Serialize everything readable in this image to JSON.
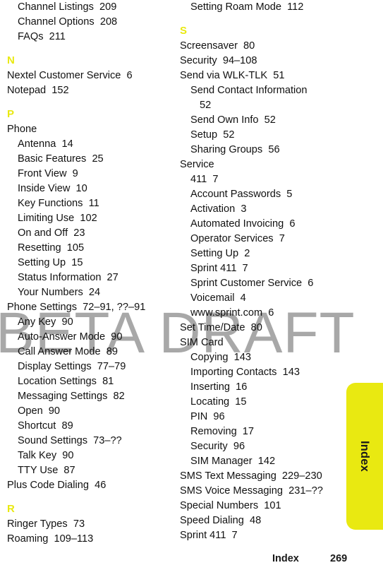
{
  "document": {
    "page_number": "269",
    "footer_label": "Index",
    "watermark_text": "BETA DRAFT",
    "tab_label": "Index",
    "accent_color": "#e9e911",
    "watermark_color": "#a8a8a8",
    "text_color": "#111111"
  },
  "columns": [
    {
      "id": "left",
      "blocks": [
        {
          "type": "entry",
          "level": 1,
          "text": "Channel Listings  209"
        },
        {
          "type": "entry",
          "level": 1,
          "text": "Channel Options  208"
        },
        {
          "type": "entry",
          "level": 1,
          "text": "FAQs  211"
        },
        {
          "type": "letter",
          "text": "N"
        },
        {
          "type": "entry",
          "level": 0,
          "text": "Nextel Customer Service  6"
        },
        {
          "type": "entry",
          "level": 0,
          "text": "Notepad  152"
        },
        {
          "type": "letter",
          "text": "P"
        },
        {
          "type": "entry",
          "level": 0,
          "text": "Phone"
        },
        {
          "type": "entry",
          "level": 1,
          "text": "Antenna  14"
        },
        {
          "type": "entry",
          "level": 1,
          "text": "Basic Features  25"
        },
        {
          "type": "entry",
          "level": 1,
          "text": "Front View  9"
        },
        {
          "type": "entry",
          "level": 1,
          "text": "Inside View  10"
        },
        {
          "type": "entry",
          "level": 1,
          "text": "Key Functions  11"
        },
        {
          "type": "entry",
          "level": 1,
          "text": "Limiting Use  102"
        },
        {
          "type": "entry",
          "level": 1,
          "text": "On and Off  23"
        },
        {
          "type": "entry",
          "level": 1,
          "text": "Resetting  105"
        },
        {
          "type": "entry",
          "level": 1,
          "text": "Setting Up  15"
        },
        {
          "type": "entry",
          "level": 1,
          "text": "Status Information  27"
        },
        {
          "type": "entry",
          "level": 1,
          "text": "Your Numbers  24"
        },
        {
          "type": "entry",
          "level": 0,
          "text": "Phone Settings  72–91, ??–91"
        },
        {
          "type": "entry",
          "level": 1,
          "text": "Any Key  90"
        },
        {
          "type": "entry",
          "level": 1,
          "text": "Auto-Answer Mode  90"
        },
        {
          "type": "entry",
          "level": 1,
          "text": "Call Answer Mode  89"
        },
        {
          "type": "entry",
          "level": 1,
          "text": "Display Settings  77–79"
        },
        {
          "type": "entry",
          "level": 1,
          "text": "Location Settings  81"
        },
        {
          "type": "entry",
          "level": 1,
          "text": "Messaging Settings  82"
        },
        {
          "type": "entry",
          "level": 1,
          "text": "Open  90"
        },
        {
          "type": "entry",
          "level": 1,
          "text": "Shortcut  89"
        },
        {
          "type": "entry",
          "level": 1,
          "text": "Sound Settings  73–??"
        },
        {
          "type": "entry",
          "level": 1,
          "text": "Talk Key  90"
        },
        {
          "type": "entry",
          "level": 1,
          "text": "TTY Use  87"
        },
        {
          "type": "entry",
          "level": 0,
          "text": "Plus Code Dialing  46"
        },
        {
          "type": "letter",
          "text": "R"
        },
        {
          "type": "entry",
          "level": 0,
          "text": "Ringer Types  73"
        },
        {
          "type": "entry",
          "level": 0,
          "text": "Roaming  109–113"
        }
      ]
    },
    {
      "id": "right",
      "blocks": [
        {
          "type": "entry",
          "level": 1,
          "text": "Setting Roam Mode  112"
        },
        {
          "type": "letter",
          "text": "S"
        },
        {
          "type": "entry",
          "level": 0,
          "text": "Screensaver  80"
        },
        {
          "type": "entry",
          "level": 0,
          "text": "Security  94–108"
        },
        {
          "type": "entry",
          "level": 0,
          "text": "Send via WLK-TLK  51"
        },
        {
          "type": "entry",
          "level": 1,
          "text": "Send Contact Information"
        },
        {
          "type": "entry",
          "level": 1,
          "continuation": true,
          "text": "52"
        },
        {
          "type": "entry",
          "level": 1,
          "text": "Send Own Info  52"
        },
        {
          "type": "entry",
          "level": 1,
          "text": "Setup  52"
        },
        {
          "type": "entry",
          "level": 1,
          "text": "Sharing Groups  56"
        },
        {
          "type": "entry",
          "level": 0,
          "text": "Service"
        },
        {
          "type": "entry",
          "level": 1,
          "text": "411  7"
        },
        {
          "type": "entry",
          "level": 1,
          "text": "Account Passwords  5"
        },
        {
          "type": "entry",
          "level": 1,
          "text": "Activation  3"
        },
        {
          "type": "entry",
          "level": 1,
          "text": "Automated Invoicing  6"
        },
        {
          "type": "entry",
          "level": 1,
          "text": "Operator Services  7"
        },
        {
          "type": "entry",
          "level": 1,
          "text": "Setting Up  2"
        },
        {
          "type": "entry",
          "level": 1,
          "text": "Sprint 411  7"
        },
        {
          "type": "entry",
          "level": 1,
          "text": "Sprint Customer Service  6"
        },
        {
          "type": "entry",
          "level": 1,
          "text": "Voicemail  4"
        },
        {
          "type": "entry",
          "level": 1,
          "text": "www.sprint.com  6"
        },
        {
          "type": "entry",
          "level": 0,
          "text": "Set Time/Date  80"
        },
        {
          "type": "entry",
          "level": 0,
          "text": "SIM Card"
        },
        {
          "type": "entry",
          "level": 1,
          "text": "Copying  143"
        },
        {
          "type": "entry",
          "level": 1,
          "text": "Importing Contacts  143"
        },
        {
          "type": "entry",
          "level": 1,
          "text": "Inserting  16"
        },
        {
          "type": "entry",
          "level": 1,
          "text": "Locating  15"
        },
        {
          "type": "entry",
          "level": 1,
          "text": "PIN  96"
        },
        {
          "type": "entry",
          "level": 1,
          "text": "Removing  17"
        },
        {
          "type": "entry",
          "level": 1,
          "text": "Security  96"
        },
        {
          "type": "entry",
          "level": 1,
          "text": "SIM Manager  142"
        },
        {
          "type": "entry",
          "level": 0,
          "text": "SMS Text Messaging  229–230"
        },
        {
          "type": "entry",
          "level": 0,
          "text": "SMS Voice Messaging  231–??"
        },
        {
          "type": "entry",
          "level": 0,
          "text": "Special Numbers  101"
        },
        {
          "type": "entry",
          "level": 0,
          "text": "Speed Dialing  48"
        },
        {
          "type": "entry",
          "level": 0,
          "text": "Sprint 411  7"
        }
      ]
    }
  ]
}
